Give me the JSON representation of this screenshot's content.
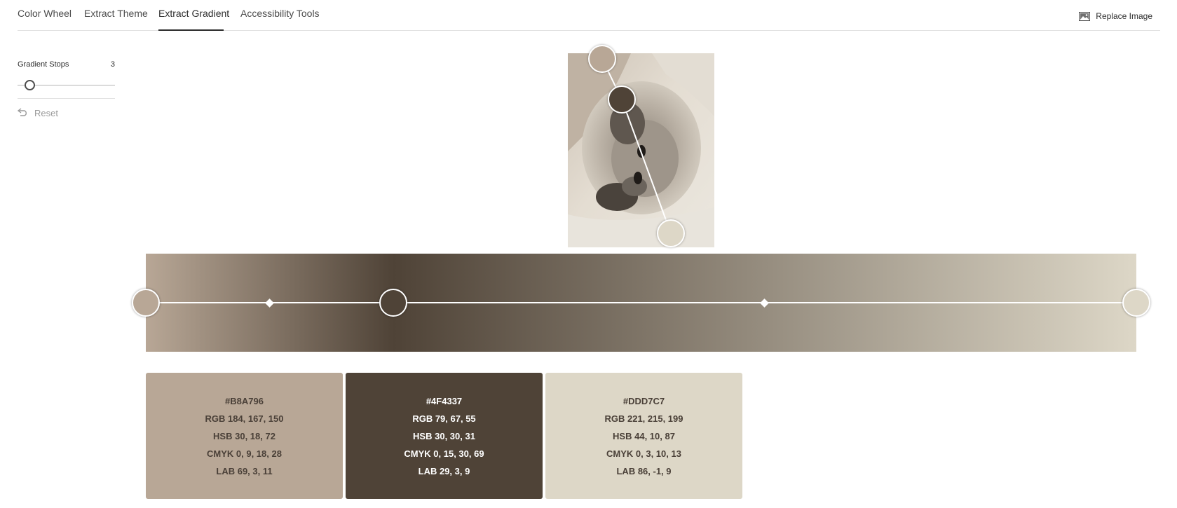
{
  "tabs": {
    "color_wheel": "Color Wheel",
    "extract_theme": "Extract Theme",
    "extract_gradient": "Extract Gradient",
    "accessibility_tools": "Accessibility Tools"
  },
  "replace_image": {
    "label": "Replace Image",
    "icon": "image-icon"
  },
  "left_panel": {
    "gradient_stops_label": "Gradient Stops",
    "gradient_stops_value": "3",
    "reset_label": "Reset",
    "reset_icon": "undo-icon"
  },
  "colors": {
    "stop1": "#B8A796",
    "stop2": "#4F4337",
    "stop3": "#DDD7C7"
  },
  "swatches": [
    {
      "hex": "#B8A796",
      "rgb": "RGB 184, 167, 150",
      "hsb": "HSB 30, 18, 72",
      "cmyk": "CMYK 0, 9, 18, 28",
      "lab": "LAB 69, 3, 11"
    },
    {
      "hex": "#4F4337",
      "rgb": "RGB 79, 67, 55",
      "hsb": "HSB 30, 30, 31",
      "cmyk": "CMYK 0, 15, 30, 69",
      "lab": "LAB 29, 3, 9"
    },
    {
      "hex": "#DDD7C7",
      "rgb": "RGB 221, 215, 199",
      "hsb": "HSB 44, 10, 87",
      "cmyk": "CMYK 0, 3, 10, 13",
      "lab": "LAB 86, -1, 9"
    }
  ]
}
